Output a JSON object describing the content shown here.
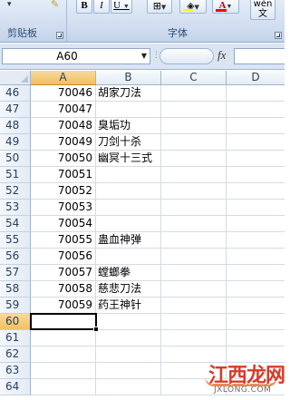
{
  "ribbon": {
    "groups": [
      {
        "label": "剪贴板"
      },
      {
        "label": "字体"
      }
    ],
    "buttons": {
      "bold": "B",
      "italic": "I",
      "underline": "U",
      "font_color": "A",
      "phonetic": "wén",
      "phonetic_char": "文"
    }
  },
  "formula_bar": {
    "name_box": "A60",
    "fx_label": "fx",
    "formula": ""
  },
  "grid": {
    "columns": [
      "A",
      "B",
      "C",
      "D"
    ],
    "selected_column": "A",
    "rows": [
      {
        "n": "46",
        "a": "70046",
        "b": "胡家刀法"
      },
      {
        "n": "47",
        "a": "70047",
        "b": ""
      },
      {
        "n": "48",
        "a": "70048",
        "b": "臭垢功"
      },
      {
        "n": "49",
        "a": "70049",
        "b": "刀剑十杀"
      },
      {
        "n": "50",
        "a": "70050",
        "b": "幽冥十三式"
      },
      {
        "n": "51",
        "a": "70051",
        "b": ""
      },
      {
        "n": "52",
        "a": "70052",
        "b": ""
      },
      {
        "n": "53",
        "a": "70053",
        "b": ""
      },
      {
        "n": "54",
        "a": "70054",
        "b": ""
      },
      {
        "n": "55",
        "a": "70055",
        "b": "蛊血神弹"
      },
      {
        "n": "56",
        "a": "70056",
        "b": ""
      },
      {
        "n": "57",
        "a": "70057",
        "b": "螳螂拳"
      },
      {
        "n": "58",
        "a": "70058",
        "b": "慈悲刀法"
      },
      {
        "n": "59",
        "a": "70059",
        "b": "药王神针"
      },
      {
        "n": "60",
        "a": "",
        "b": ""
      },
      {
        "n": "61",
        "a": "",
        "b": ""
      },
      {
        "n": "62",
        "a": "",
        "b": ""
      },
      {
        "n": "63",
        "a": "",
        "b": ""
      },
      {
        "n": "64",
        "a": "",
        "b": ""
      }
    ],
    "active_cell": "A60"
  },
  "watermark": {
    "text": "江西龙网",
    "sub": "JXLONG.COM"
  },
  "colors": {
    "ribbon_bg": "#cfdcef",
    "header_selected": "#f1c15f",
    "gridline": "#d4dbe5"
  }
}
